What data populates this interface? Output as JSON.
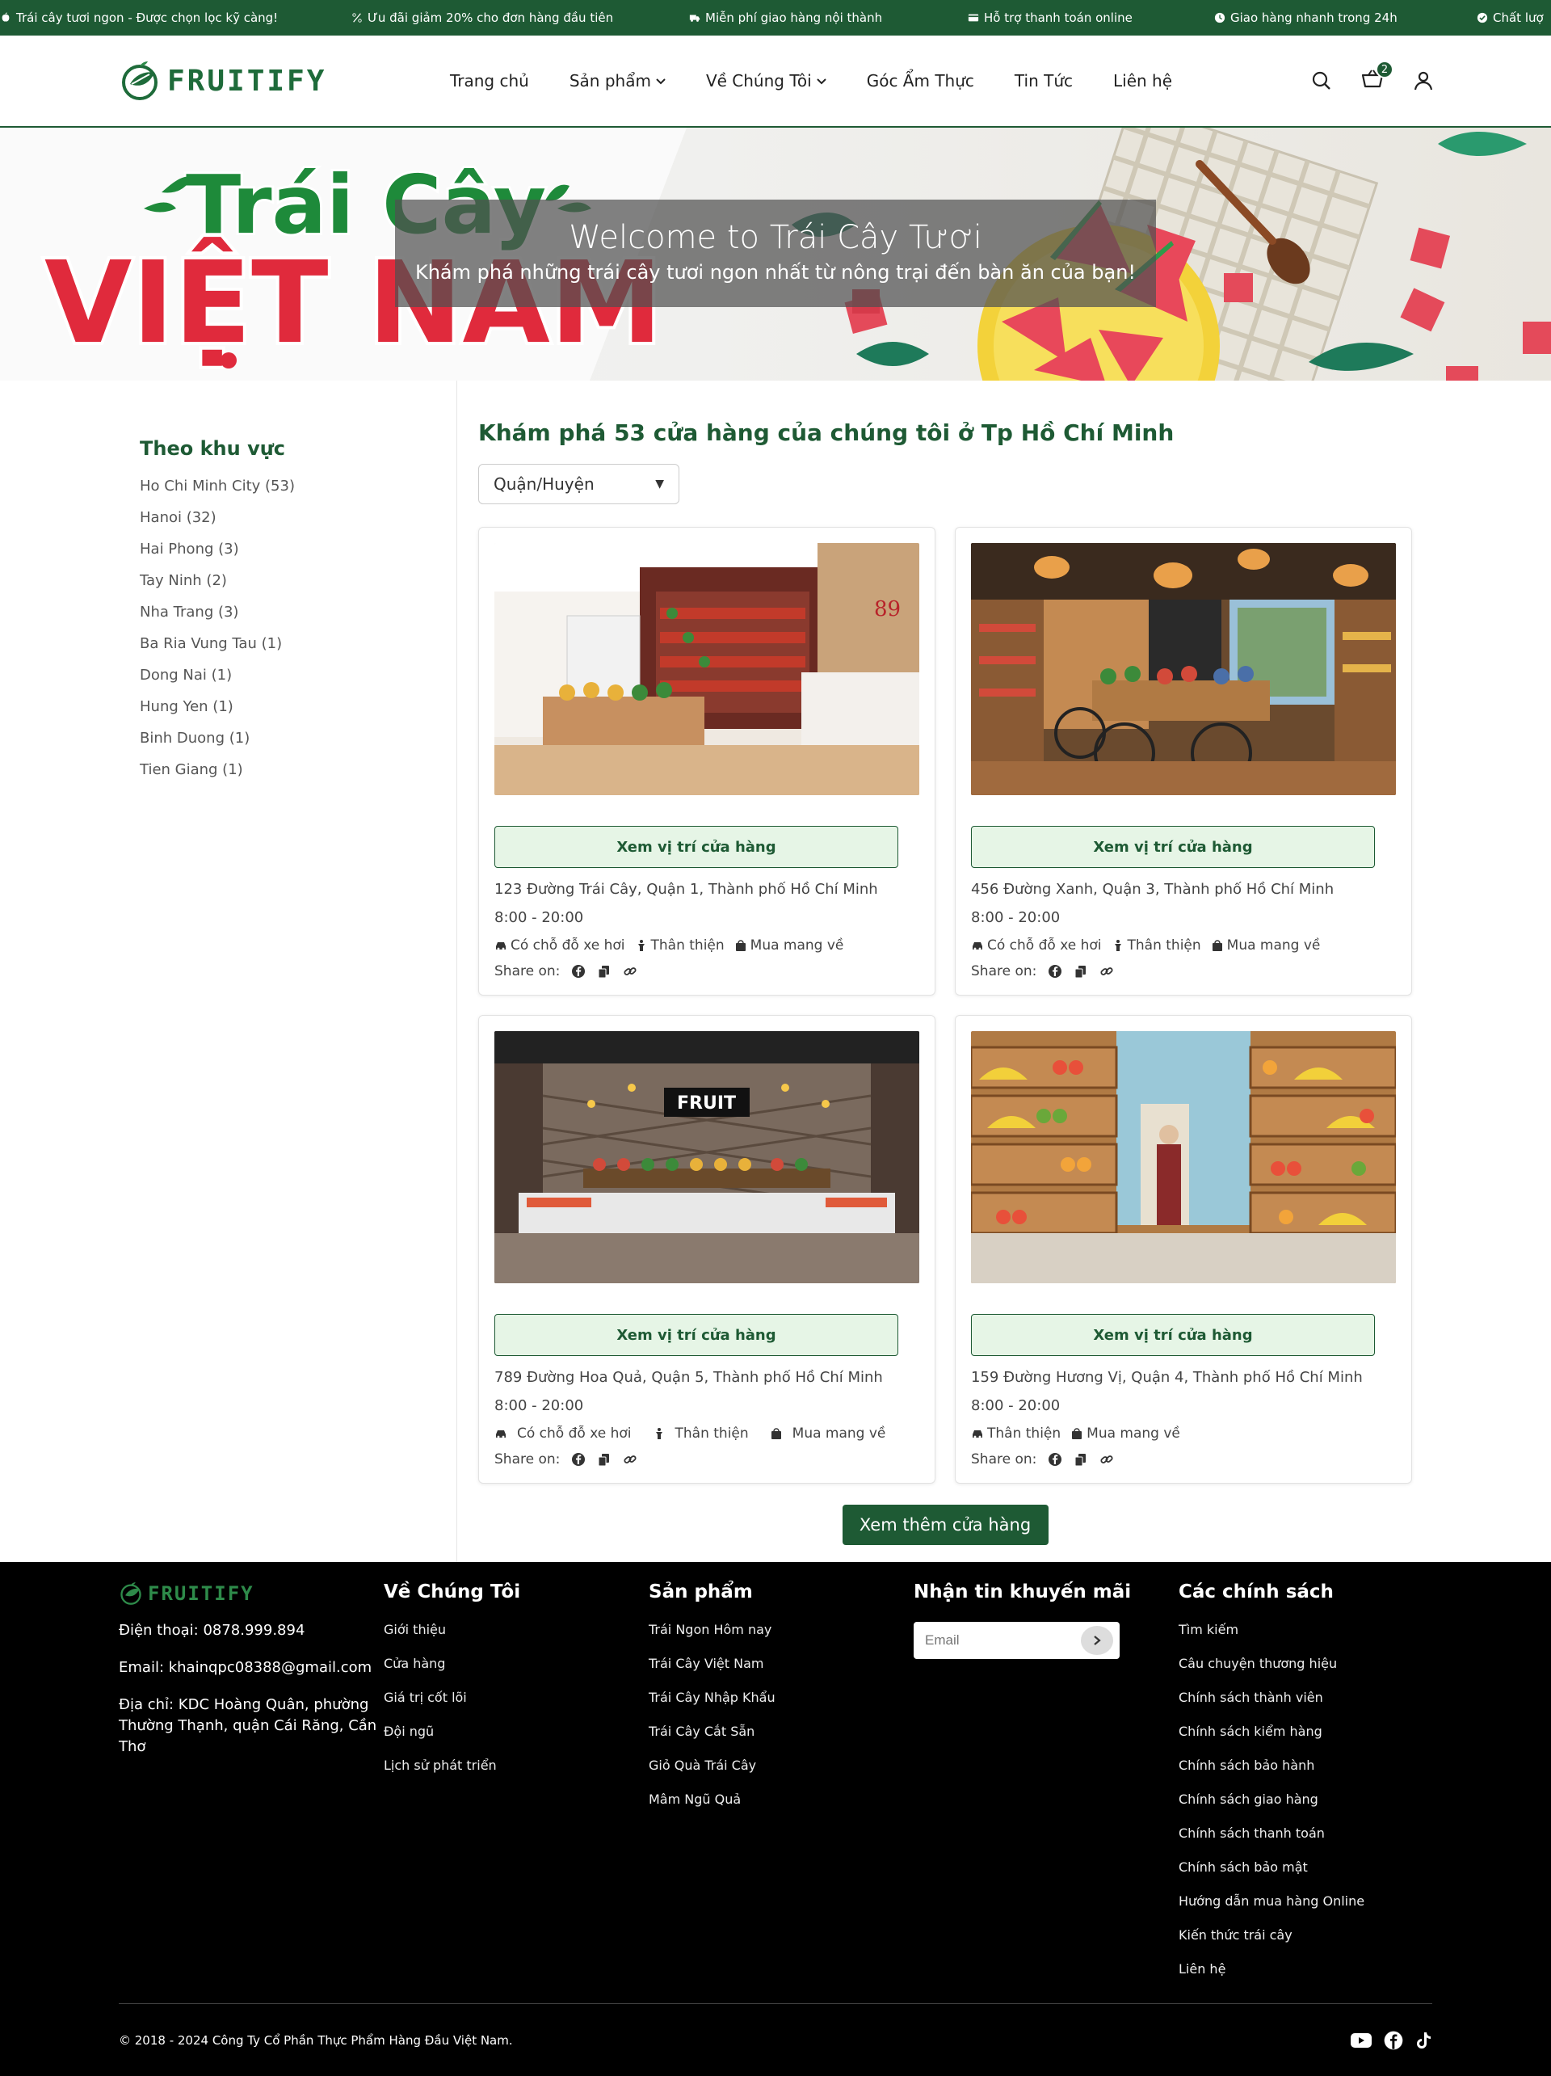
{
  "topbar": {
    "messages": [
      "Trái cây tươi ngon - Được chọn lọc kỹ càng!",
      "Ưu đãi giảm 20% cho đơn hàng đầu tiên",
      "Miễn phí giao hàng nội thành",
      "Hỗ trợ thanh toán online",
      "Giao hàng nhanh trong 24h",
      "Chất lượ"
    ]
  },
  "header": {
    "logo": "FRUITIFY",
    "nav": [
      "Trang chủ",
      "Sản phẩm",
      "Về Chúng Tôi",
      "Góc Ẩm Thực",
      "Tin Tức",
      "Liên hệ"
    ],
    "cart_count": "2"
  },
  "banner": {
    "brand_line1": "Trái Cây",
    "brand_line2": "VIỆT NAM",
    "title": "Welcome to Trái Cây Tươi",
    "subtitle": "Khám phá những trái cây tươi ngon nhất từ nông trại đến bàn ăn của bạn!"
  },
  "sidebar": {
    "title": "Theo khu vực",
    "regions": [
      "Ho Chi Minh City (53)",
      "Hanoi (32)",
      "Hai Phong (3)",
      "Tay Ninh (2)",
      "Nha Trang (3)",
      "Ba Ria Vung Tau (1)",
      "Dong Nai (1)",
      "Hung Yen (1)",
      "Binh Duong (1)",
      "Tien Giang (1)"
    ]
  },
  "main": {
    "heading": "Khám phá 53 cửa hàng của chúng tôi ở Tp Hồ Chí Minh",
    "district_select": "Quận/Huyện",
    "more_button": "Xem thêm cửa hàng"
  },
  "stores": [
    {
      "button": "Xem vị trí cửa hàng",
      "address": "123 Đường Trái Cây, Quận 1, Thành phố Hồ Chí Minh",
      "hours": "8:00 - 20:00",
      "features": [
        "Có chỗ đỗ xe hơi",
        "Thân thiện",
        "Mua mang về"
      ],
      "share": "Share on:"
    },
    {
      "button": "Xem vị trí cửa hàng",
      "address": "456 Đường Xanh, Quận 3, Thành phố Hồ Chí Minh",
      "hours": "8:00 - 20:00",
      "features": [
        "Có chỗ đỗ xe hơi",
        "Thân thiện",
        "Mua mang về"
      ],
      "share": "Share on:"
    },
    {
      "button": "Xem vị trí cửa hàng",
      "address": "789 Đường Hoa Quả, Quận 5, Thành phố Hồ Chí Minh",
      "hours": "8:00 - 20:00",
      "features": [
        "Có chỗ đỗ xe hơi",
        "Thân thiện",
        "Mua mang về"
      ],
      "share": "Share on:"
    },
    {
      "button": "Xem vị trí cửa hàng",
      "address": "159 Đường Hương Vị, Quận 4, Thành phố Hồ Chí Minh",
      "hours": "8:00 - 20:00",
      "features": [
        "Thân thiện",
        "Mua mang về"
      ],
      "share": "Share on:"
    }
  ],
  "footer": {
    "logo": "FRUITIFY",
    "phone": "Điện thoại: 0878.999.894",
    "email": "Email: khainqpc08388@gmail.com",
    "address": "Địa chỉ: KDC Hoàng Quân, phường Thường Thạnh, quận Cái Răng, Cần Thơ",
    "about_title": "Về Chúng Tôi",
    "about_links": [
      "Giới thiệu",
      "Cửa hàng",
      "Giá trị cốt lõi",
      "Đội ngũ",
      "Lịch sử phát triển"
    ],
    "products_title": "Sản phẩm",
    "product_links": [
      "Trái Ngon Hôm nay",
      "Trái Cây Việt Nam",
      "Trái Cây Nhập Khẩu",
      "Trái Cây Cắt Sẵn",
      "Giỏ Quà Trái Cây",
      "Mâm Ngũ Quả"
    ],
    "newsletter_title": "Nhận tin khuyến mãi",
    "email_placeholder": "Email",
    "policy_title": "Các chính sách",
    "policy_links": [
      "Tìm kiếm",
      "Câu chuyện thương hiệu",
      "Chính sách thành viên",
      "Chính sách kiểm hàng",
      "Chính sách bảo hành",
      "Chính sách giao hàng",
      "Chính sách thanh toán",
      "Chính sách bảo mật",
      "Hướng dẫn mua hàng Online",
      "Kiến thức trái cây",
      "Liên hệ"
    ],
    "copyright": "© 2018 - 2024 Công Ty Cổ Phần Thực Phẩm Hàng Đầu Việt Nam."
  },
  "colors": {
    "brand_green": "#1e5a34",
    "button_bg": "#e6f5e6",
    "banner_red": "#e02a3c"
  }
}
